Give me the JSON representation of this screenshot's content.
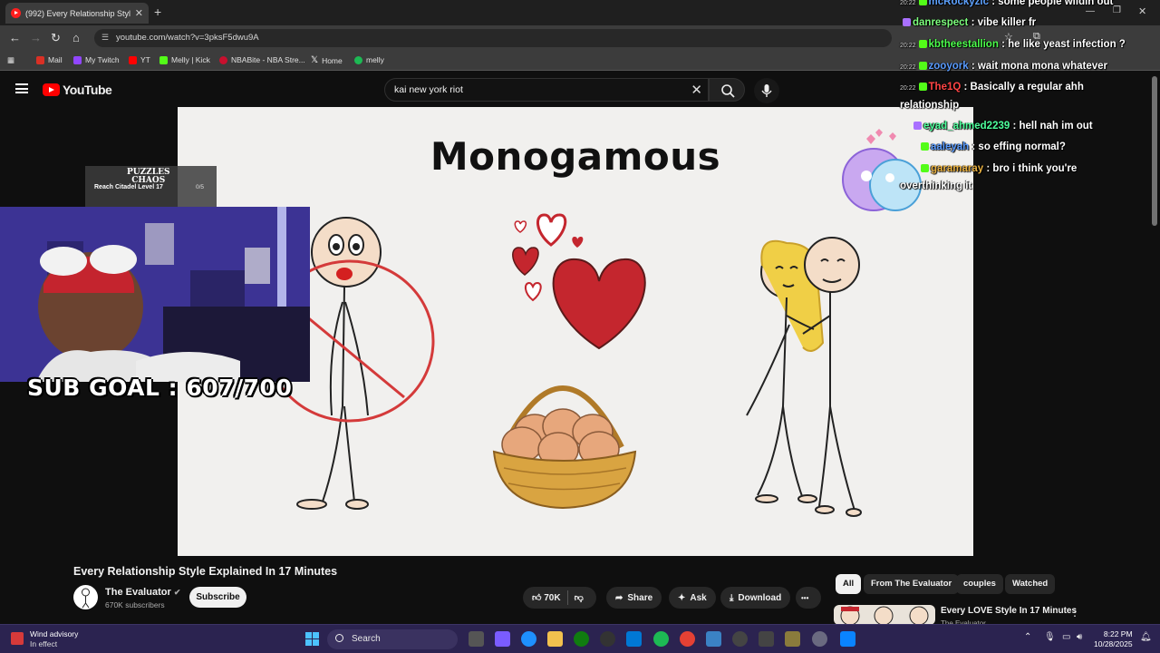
{
  "browser": {
    "tab_title": "(992) Every Relationship Style E",
    "tab_close": "✕",
    "new_tab": "+",
    "url": "youtube.com/watch?v=3pksF5dwu9A",
    "bookmarks": [
      {
        "label": "Mail",
        "color": "#d93025"
      },
      {
        "label": "My Twitch",
        "color": "#9146ff"
      },
      {
        "label": "YT",
        "color": "#ff0000"
      },
      {
        "label": "Melly | Kick",
        "color": "#53fc18"
      },
      {
        "label": "NBABite - NBA Stre...",
        "color": "#c8102e"
      },
      {
        "label": "Home",
        "color": "#000000"
      },
      {
        "label": "melly",
        "color": "#1db954"
      }
    ]
  },
  "youtube": {
    "logo_text": "YouTube",
    "search_value": "kai new york riot",
    "clear": "✕"
  },
  "video": {
    "frame_title": "Monogamous",
    "title": "Every Relationship Style Explained In 17 Minutes",
    "channel": "The Evaluator",
    "verified": "✔",
    "subscribers": "670K subscribers",
    "subscribe": "Subscribe",
    "likes": "70K",
    "share": "Share",
    "ask": "Ask",
    "download": "Download",
    "more": "•••"
  },
  "overlay": {
    "puzzles_logo_1": "PUZZLES",
    "puzzles_logo_2": "CHAOS",
    "puzzle_goal": "Reach Citadel Level 17",
    "puzzle_count": "0/5",
    "sub_goal": "SUB GOAL : 607/700"
  },
  "chat": [
    {
      "ts": "20:22",
      "user": "mcRockyzic",
      "color": "#5ea2ff",
      "badge": "#53fc18",
      "text": ": some people wildin out"
    },
    {
      "ts": "",
      "user": "danrespect",
      "color": "#7dff7d",
      "badge": "#a970ff",
      "text": ": vibe killer fr"
    },
    {
      "ts": "20:22",
      "user": "kbtheestallion",
      "color": "#4dff4d",
      "badge": "#53fc18",
      "text": ": he like yeast infection ?"
    },
    {
      "ts": "20:22",
      "user": "zooyork",
      "color": "#5a9cff",
      "badge": "#53fc18",
      "text": ": wait mona mona whatever"
    },
    {
      "ts": "20:22",
      "user": "The1Q",
      "color": "#ff4545",
      "badge": "#53fc18",
      "text": ": Basically a regular ahh"
    },
    {
      "ts": "",
      "user": "",
      "color": "#ffffff",
      "badge": "",
      "text": "relationship"
    },
    {
      "ts": "",
      "user": "eyad_ahmed2239",
      "color": "#4dff9c",
      "badge": "#a970ff",
      "text": ": hell nah im out"
    },
    {
      "ts": "",
      "user": "aaleyah",
      "color": "#5a9cff",
      "badge": "#53fc18",
      "text": ": so effing normal?"
    },
    {
      "ts": "",
      "user": "garamaray",
      "color": "#e8b040",
      "badge": "#53fc18",
      "text": ": bro i think you're"
    },
    {
      "ts": "",
      "user": "",
      "color": "#ffffff",
      "badge": "",
      "text": "overthinking it"
    }
  ],
  "sidebar": {
    "chips": [
      "All",
      "From The Evaluator",
      "couples",
      "Watched"
    ],
    "rec_title": "Every LOVE Style In 17 Minutes",
    "rec_channel": "The Evaluator",
    "rec_more": "⋮"
  },
  "taskbar": {
    "weather_1": "Wind advisory",
    "weather_2": "In effect",
    "search": "Search",
    "time": "8:22 PM",
    "date": "10/28/2025"
  },
  "colors": {
    "heart_red": "#c4262e",
    "basket": "#d9a441",
    "egg": "#e7a77c",
    "hair": "#f0cf46"
  }
}
